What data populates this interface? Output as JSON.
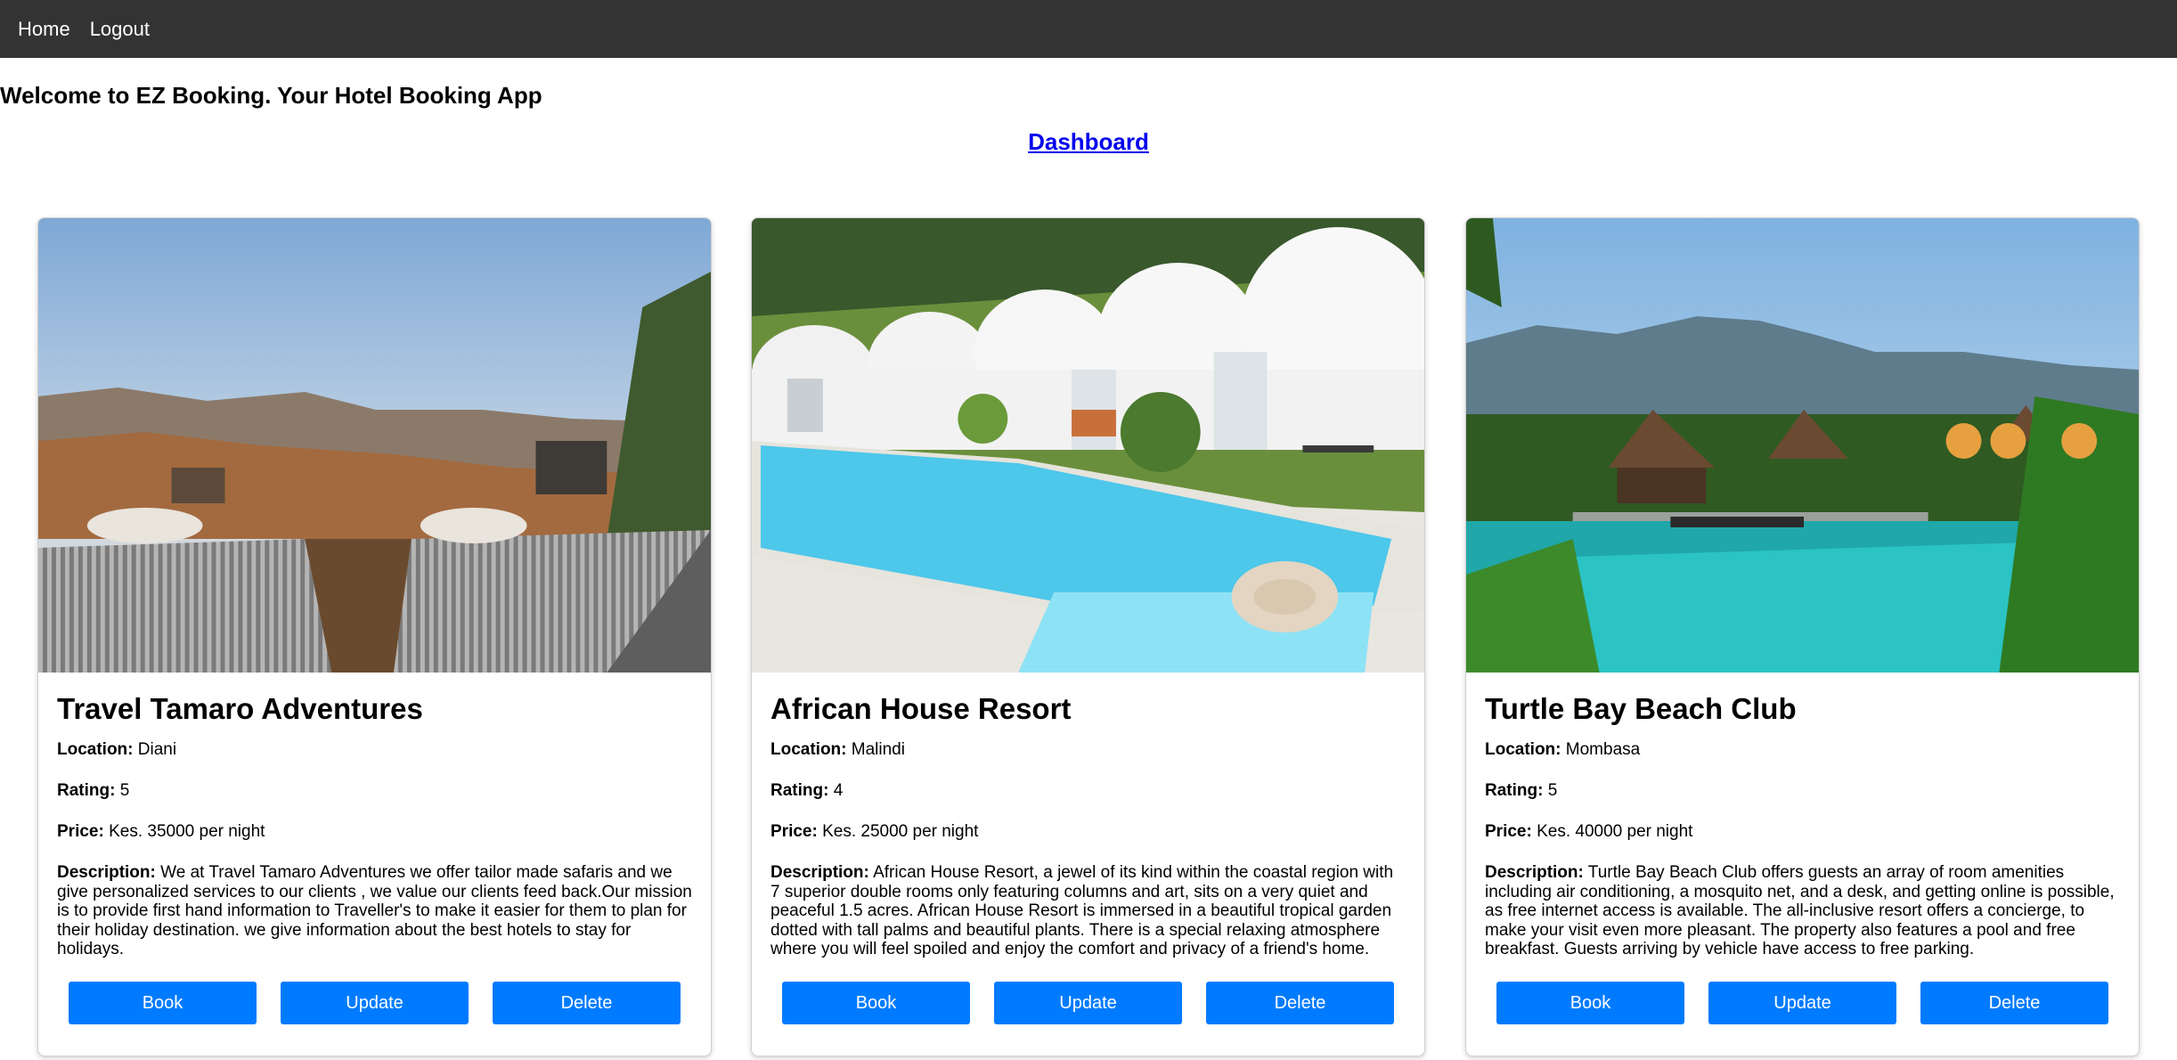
{
  "nav": {
    "home": "Home",
    "logout": "Logout"
  },
  "welcome": "Welcome to EZ Booking. Your Hotel Booking App",
  "dashboard": "Dashboard",
  "labels": {
    "location": "Location:",
    "rating": "Rating:",
    "price": "Price:",
    "description": "Description:"
  },
  "buttons": {
    "book": "Book",
    "update": "Update",
    "delete": "Delete"
  },
  "hotels": [
    {
      "name": "Travel Tamaro Adventures",
      "location": "Diani",
      "rating": "5",
      "price": "Kes. 35000 per night",
      "description": "We at Travel Tamaro Adventures we offer tailor made safaris and we give personalized services to our clients , we value our clients feed back.Our mission is to provide first hand information to Traveller's to make it easier for them to plan for their holiday destination. we give information about the best hotels to stay for holidays."
    },
    {
      "name": "African House Resort",
      "location": "Malindi",
      "rating": "4",
      "price": "Kes. 25000 per night",
      "description": "African House Resort, a jewel of its kind within the coastal region with 7 superior double rooms only featuring columns and art, sits on a very quiet and peaceful 1.5 acres. African House Resort is immersed in a beautiful tropical garden dotted with tall palms and beautiful plants. There is a special relaxing atmosphere where you will feel spoiled and enjoy the comfort and privacy of a friend's home."
    },
    {
      "name": "Turtle Bay Beach Club",
      "location": "Mombasa",
      "rating": "5",
      "price": "Kes. 40000 per night",
      "description": "Turtle Bay Beach Club offers guests an array of room amenities including air conditioning, a mosquito net, and a desk, and getting online is possible, as free internet access is available. The all-inclusive resort offers a concierge, to make your visit even more pleasant. The property also features a pool and free breakfast. Guests arriving by vehicle have access to free parking."
    }
  ]
}
